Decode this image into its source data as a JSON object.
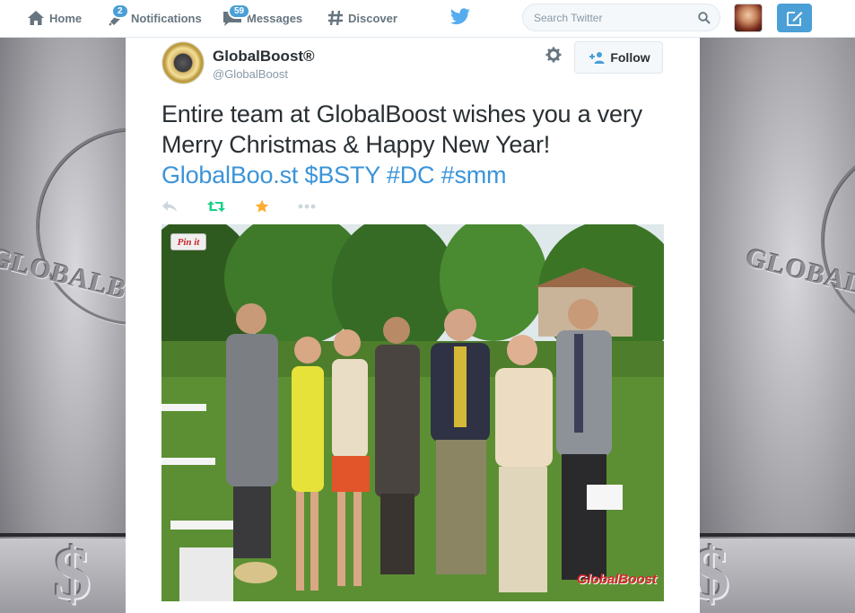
{
  "nav": {
    "home_label": "Home",
    "notifications_label": "Notifications",
    "notifications_count": "2",
    "messages_label": "Messages",
    "messages_count": "59",
    "discover_label": "Discover",
    "search_placeholder": "Search Twitter"
  },
  "tweet": {
    "author_name": "GlobalBoost®",
    "author_handle": "@GlobalBoost",
    "follow_label": "Follow",
    "text": "Entire team at GlobalBoost wishes you a very Merry Christmas & Happy New Year!",
    "links": [
      "GlobalBoo.st",
      "$BSTY",
      "#DC",
      "#smm"
    ]
  },
  "photo": {
    "pin_label": "Pin it",
    "watermark": "GlobalBoost"
  },
  "background": {
    "emboss_text": "GLOBALBO",
    "emboss_symbol": "$"
  },
  "colors": {
    "link": "#3b94d9",
    "accent": "#4a9fd6",
    "retweet": "#19cf86",
    "favorite": "#ffac33"
  },
  "icons": [
    "home-icon",
    "notifications-icon",
    "messages-icon",
    "discover-icon",
    "twitter-bird-icon",
    "search-icon",
    "compose-icon",
    "gear-icon",
    "follow-person-icon",
    "reply-icon",
    "retweet-icon",
    "favorite-icon",
    "more-icon"
  ]
}
